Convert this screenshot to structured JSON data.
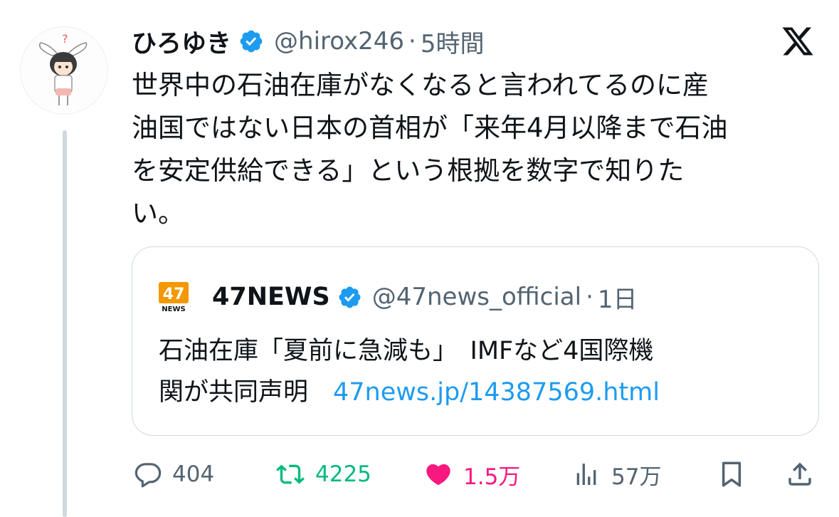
{
  "author": {
    "name": "ひろゆき",
    "handle": "@hirox246",
    "separator": "·",
    "time": "5時間"
  },
  "tweet": {
    "text": "世界中の石油在庫がなくなると言われてるのに産\n油国ではない日本の首相が「来年4月以降まで石油\nを安定供給できる」という根拠を数字で知りた\nい。"
  },
  "quote": {
    "logo_text": "47",
    "logo_sub": "NEWS",
    "name": "47NEWS",
    "handle": "@47news_official",
    "separator": "·",
    "time": "1日",
    "text": "石油在庫「夏前に急減も」　IMFなど4国際機\n関が共同声明",
    "link": "47news.jp/14387569.html"
  },
  "metrics": {
    "replies": "404",
    "retweets": "4225",
    "likes": "1.5万",
    "views": "57万"
  },
  "colors": {
    "verified": "#1d9bf0",
    "retweet": "#00ba7c",
    "like": "#f91880",
    "muted": "#536471",
    "link": "#1d9bf0",
    "logo_orange": "#f39800"
  },
  "icons": [
    "verified-badge-icon",
    "x-logo-icon",
    "reply-icon",
    "retweet-icon",
    "like-icon",
    "views-icon",
    "bookmark-icon",
    "share-icon"
  ]
}
